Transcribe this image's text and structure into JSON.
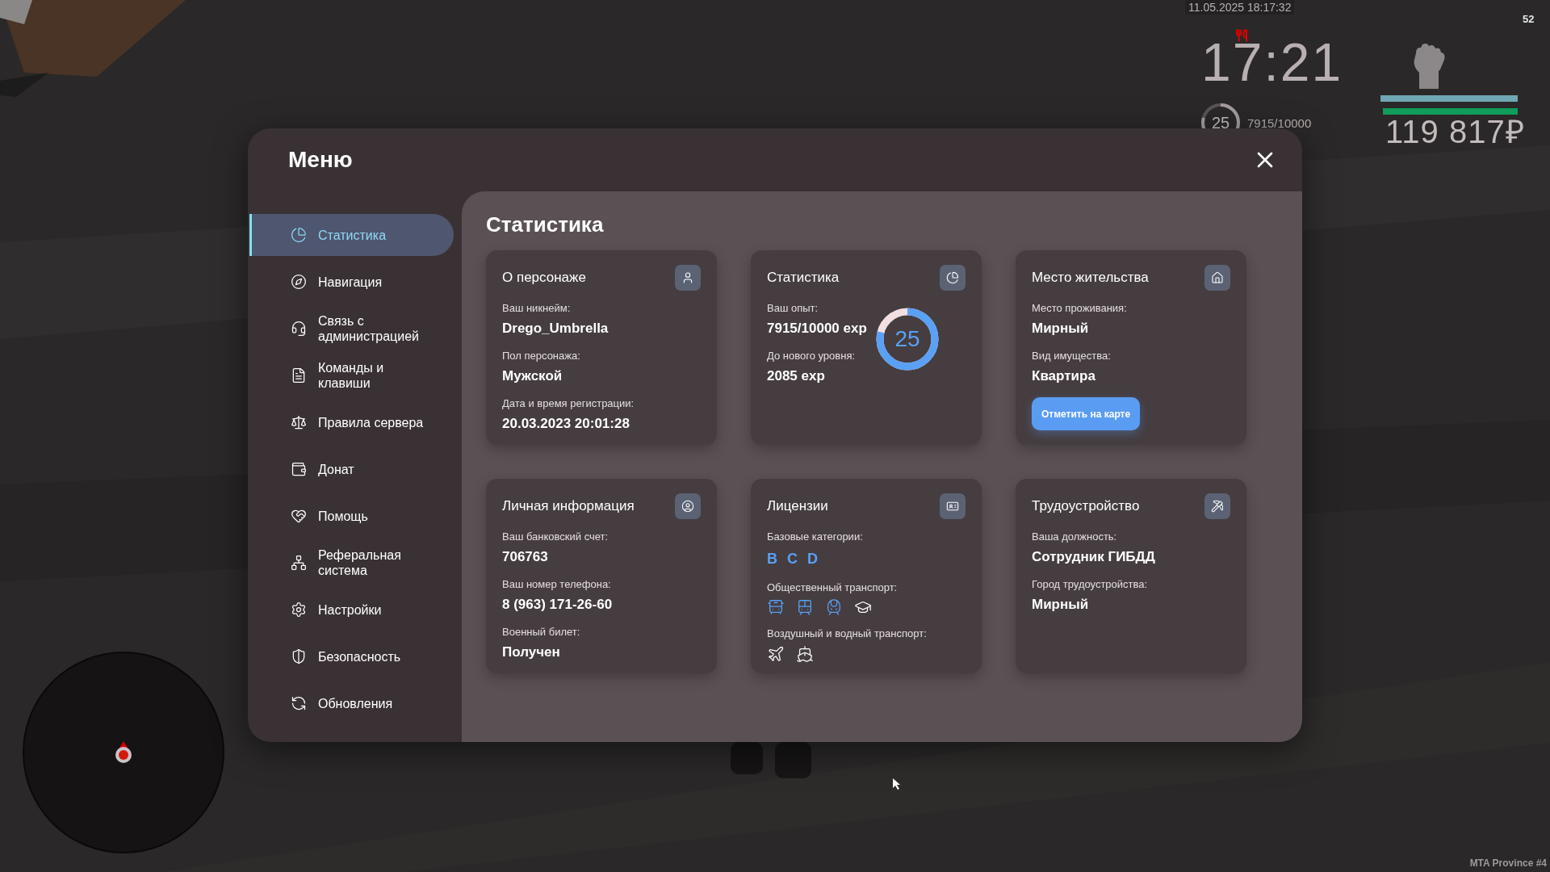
{
  "hud": {
    "datetime": "11.05.2025 18:17:32",
    "fps": "52",
    "clock": "17:21",
    "level_text": "25",
    "xp": "7915/10000",
    "xp_ring": {
      "level": 0.79
    },
    "bars": [
      {
        "level": 1,
        "color": "#6fa7b5"
      },
      {
        "level": 0.98,
        "color": "#109c5a"
      }
    ],
    "money": "119 817₽"
  },
  "menu": {
    "title": "Меню",
    "sidebar": [
      {
        "label": "Статистика",
        "selected": true
      },
      {
        "label": "Навигация",
        "selected": false
      },
      {
        "label": "Связь с\nадминистрацией",
        "selected": false
      },
      {
        "label": "Команды и\nклавиши",
        "selected": false
      },
      {
        "label": "Правила сервера",
        "selected": false
      },
      {
        "label": "Донат",
        "selected": false
      },
      {
        "label": "Помощь",
        "selected": false
      },
      {
        "label": "Реферальная\nсистема",
        "selected": false
      },
      {
        "label": "Настройки",
        "selected": false
      },
      {
        "label": "Безопасность",
        "selected": false
      },
      {
        "label": "Обновления",
        "selected": false
      }
    ],
    "page_title": "Статистика",
    "cards": [
      {
        "title": "О персонаже",
        "rows": [
          {
            "kind": "field",
            "label": "Ваш никнейм:",
            "value": "Drego_Umbrella"
          },
          {
            "kind": "field",
            "label": "Пол персонажа:",
            "value": "Мужской"
          },
          {
            "kind": "field",
            "label": "Дата и время регистрации:",
            "value": "20.03.2023 20:01:28"
          }
        ]
      },
      {
        "title": "Статистика",
        "rows": [
          {
            "kind": "field",
            "label": "Ваш опыт:",
            "value": "7915/10000 exp"
          },
          {
            "kind": "field",
            "label": "До нового уровня:",
            "value": "2085 exp"
          }
        ],
        "ring": {
          "value": "25",
          "level": 0.79
        }
      },
      {
        "title": "Место жительства",
        "rows": [
          {
            "kind": "field",
            "label": "Место проживания:",
            "value": "Мирный"
          },
          {
            "kind": "field",
            "label": "Вид имущества:",
            "value": "Квартира"
          },
          {
            "kind": "button",
            "label": "Отметить на карте"
          }
        ]
      },
      {
        "title": "Личная информация",
        "rows": [
          {
            "kind": "field",
            "label": "Ваш банковский счет:",
            "value": "706763"
          },
          {
            "kind": "field",
            "label": "Ваш номер телефона:",
            "value": "8 (963) 171-26-60"
          },
          {
            "kind": "field",
            "label": "Военный билет:",
            "value": "Получен"
          }
        ]
      },
      {
        "title": "Лицензии",
        "rows": [
          {
            "kind": "letters",
            "label": "Базовые категории:",
            "items": [
              "B",
              "C",
              "D"
            ]
          },
          {
            "kind": "icons",
            "label": "Общественный транспорт:",
            "items": [
              {
                "owned": true
              },
              {
                "owned": true
              },
              {
                "owned": true
              },
              {
                "owned": false
              }
            ]
          },
          {
            "kind": "icons",
            "label": "Воздушный и водный транспорт:",
            "items": [
              {
                "owned": false
              },
              {
                "owned": false
              }
            ]
          }
        ]
      },
      {
        "title": "Трудоустройство",
        "rows": [
          {
            "kind": "field",
            "label": "Ваша должность:",
            "value": "Сотрудник ГИБДД"
          },
          {
            "kind": "field",
            "label": "Город трудоустройства:",
            "value": "Мирный"
          }
        ]
      }
    ]
  },
  "server_label": "MTA Province #4"
}
